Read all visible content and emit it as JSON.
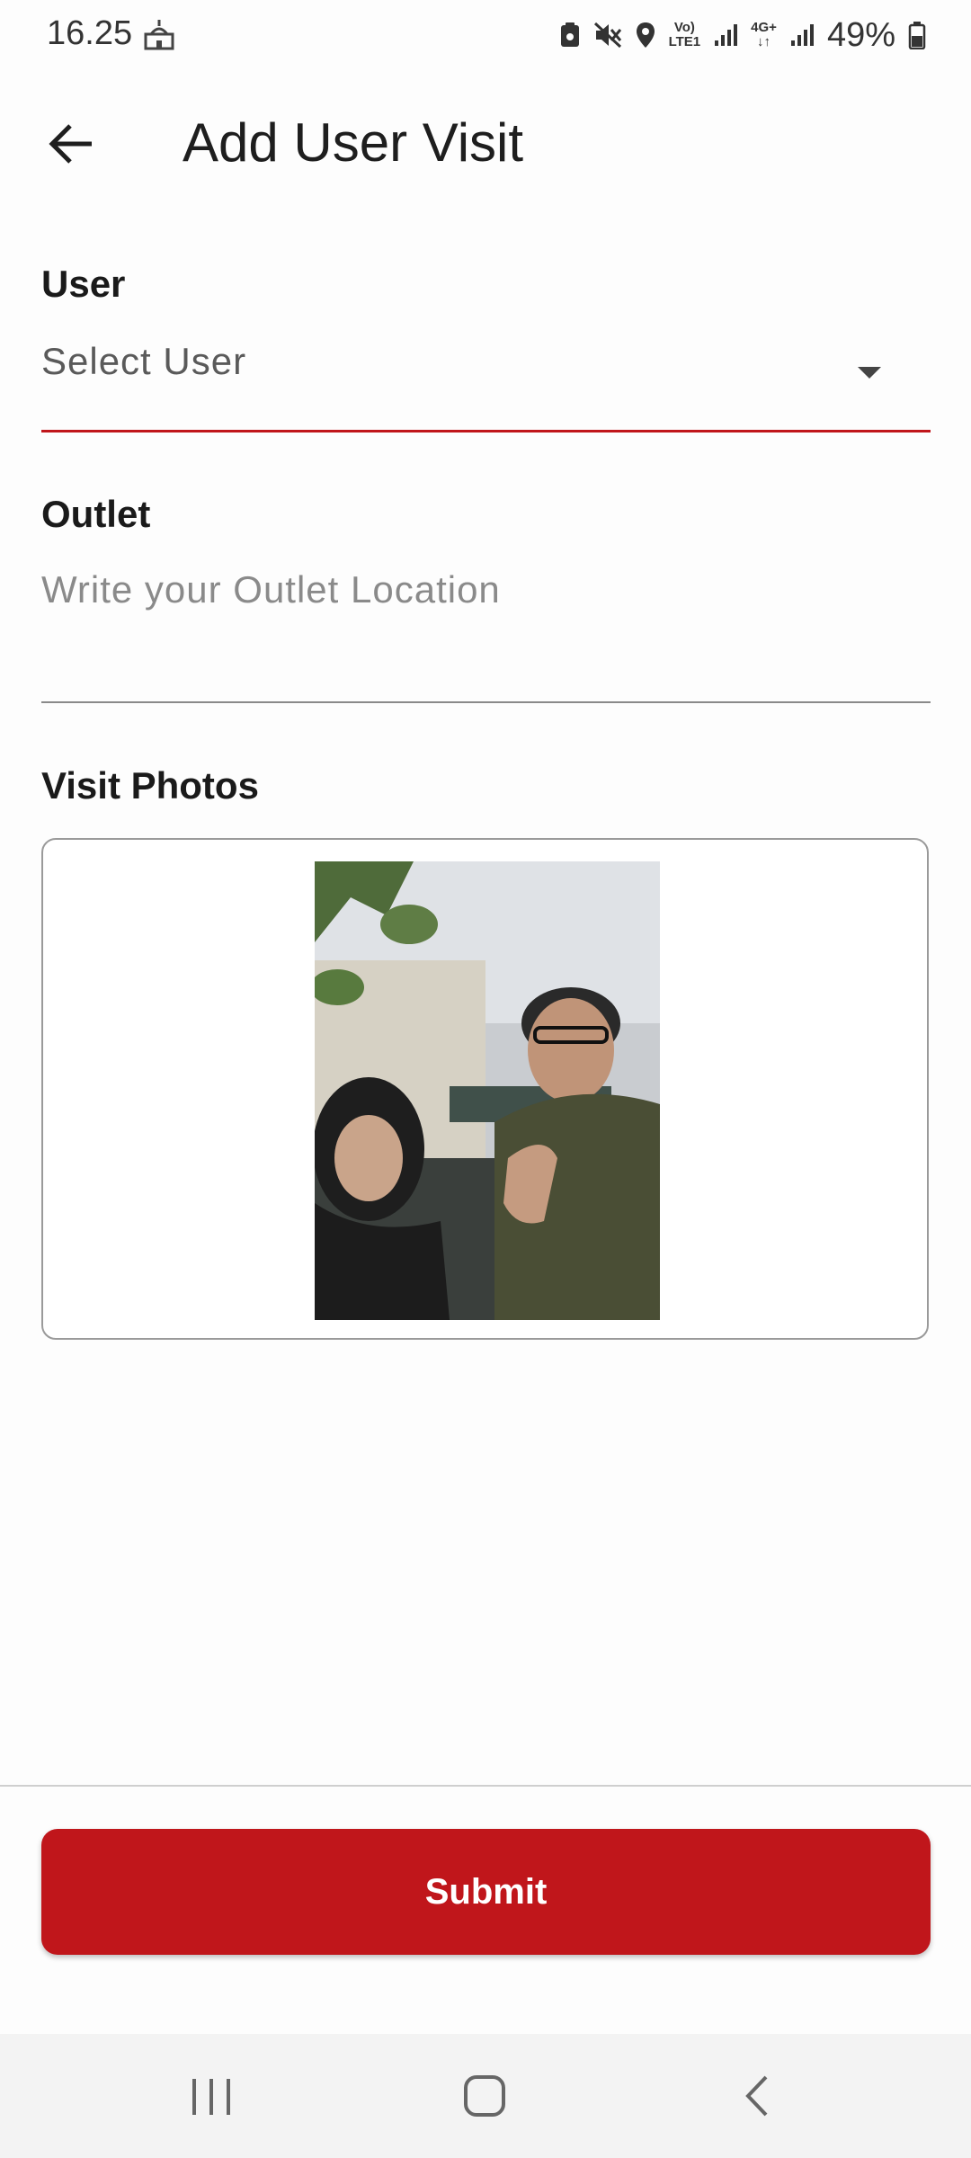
{
  "status_bar": {
    "time": "16.25",
    "mosque_icon": "mosque-icon",
    "network_volte": "Vo)",
    "network_lte": "LTE1",
    "network_4g": "4G+",
    "battery": "49%",
    "icons": [
      "save-icon",
      "mute-icon",
      "location-icon",
      "signal-icon",
      "battery-icon"
    ]
  },
  "app_bar": {
    "back_icon": "back-arrow-icon",
    "title": "Add User Visit"
  },
  "form": {
    "user": {
      "label": "User",
      "value": "Select User",
      "icon": "dropdown-arrow-icon",
      "underline_color": "#c0161b"
    },
    "outlet": {
      "label": "Outlet",
      "placeholder": "Write your Outlet Location",
      "underline_color": "#8a8a8a"
    },
    "photos": {
      "label": "Visit Photos"
    }
  },
  "submit": {
    "label": "Submit",
    "color": "#c0161b"
  },
  "nav_bar": {
    "icons": [
      "recent-apps-icon",
      "home-icon",
      "nav-back-icon"
    ]
  }
}
